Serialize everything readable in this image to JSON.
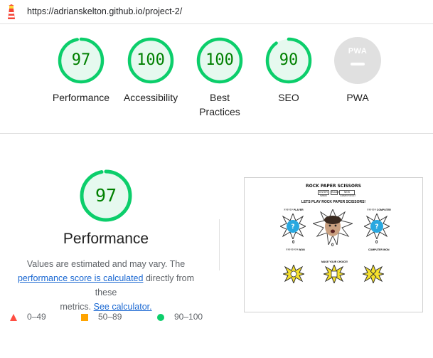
{
  "browser": {
    "url": "https://adrianskelton.github.io/project-2/"
  },
  "summary": {
    "gauges": [
      {
        "id": "performance",
        "score": "97",
        "label_lines": [
          "Performance"
        ],
        "fraction": 0.97,
        "color": "#0cce6b"
      },
      {
        "id": "accessibility",
        "score": "100",
        "label_lines": [
          "Accessibility"
        ],
        "fraction": 1.0,
        "color": "#0cce6b"
      },
      {
        "id": "best-practices",
        "score": "100",
        "label_lines": [
          "Best",
          "Practices"
        ],
        "fraction": 1.0,
        "color": "#0cce6b"
      },
      {
        "id": "seo",
        "score": "90",
        "label_lines": [
          "SEO"
        ],
        "fraction": 0.9,
        "color": "#0cce6b"
      }
    ],
    "pwa": {
      "badge_text": "PWA",
      "label": "PWA",
      "icon": "pwa-badge-icon"
    }
  },
  "performance": {
    "score": "97",
    "fraction": 0.97,
    "title": "Performance",
    "desc_part1": "Values are estimated and may vary. The",
    "desc_link1": "performance score is calculated",
    "desc_part2": "directly from these",
    "desc_part3": "metrics.",
    "desc_link2": "See calculator.",
    "legend": [
      {
        "shape": "triangle",
        "range": "0–49",
        "color": "#ff4e42"
      },
      {
        "shape": "square",
        "range": "50–89",
        "color": "#ffa400"
      },
      {
        "shape": "circle",
        "range": "90–100",
        "color": "#0cce6b"
      }
    ]
  },
  "screenshot": {
    "title": "ROCK PAPER SCISSORS",
    "buttons": [
      "ENTER NAME",
      "RULES",
      "NEW GAME/RESET"
    ],
    "subtitle": "LETS PLAY ROCK PAPER SCISSORS!",
    "player_label": "?????? PLAYER",
    "computer_label": "?????? COMPUTER",
    "player_score": "0",
    "computer_score": "0",
    "player_caption": "???????? WON",
    "computer_caption": "COMPUTER WON",
    "center_score": "0",
    "choose_label": "MAKE YOUR CHOICE!"
  },
  "colors": {
    "pass_green": "#0cce6b",
    "pass_text": "#008000",
    "pass_bg": "#e6f9ef",
    "link_blue": "#1967d2"
  }
}
